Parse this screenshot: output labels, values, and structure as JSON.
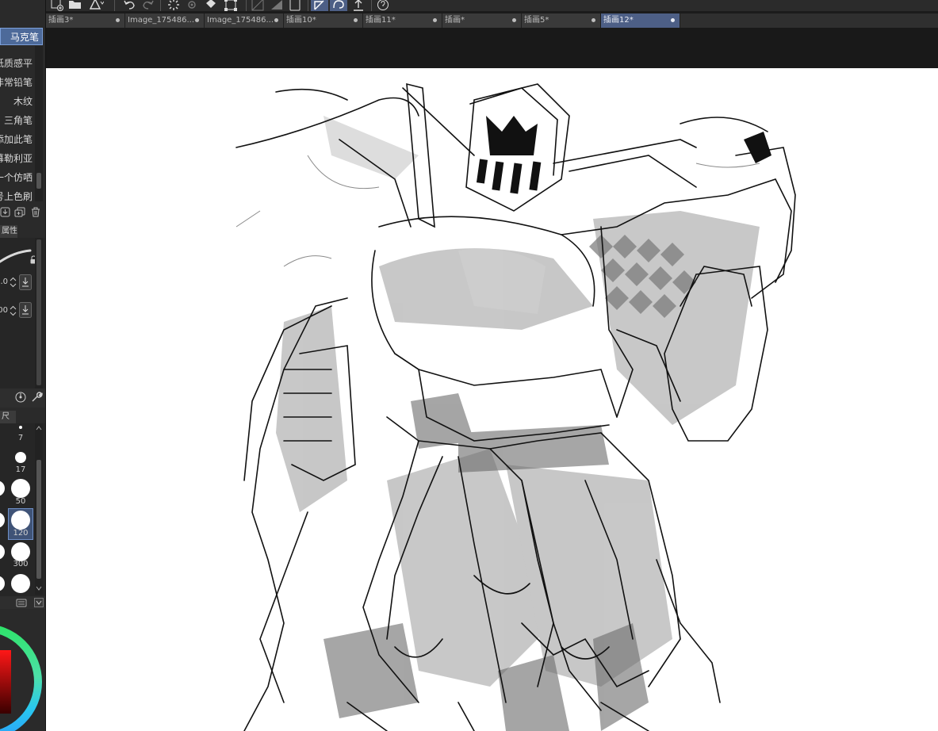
{
  "tabs": [
    {
      "label": "插画3*",
      "active": false
    },
    {
      "label": "Image_175486...",
      "active": false
    },
    {
      "label": "Image_175486...",
      "active": false
    },
    {
      "label": "插画10*",
      "active": false
    },
    {
      "label": "插画11*",
      "active": false
    },
    {
      "label": "插画*",
      "active": false
    },
    {
      "label": "插画5*",
      "active": false
    },
    {
      "label": "插画12*",
      "active": true
    }
  ],
  "brush_list": {
    "selected": "马克笔",
    "items": [
      "纸质感平",
      "非常铅笔",
      "木纹",
      "三角笔",
      "添加此笔",
      "幕勒利亚",
      "一个仿哂",
      "号上色刷"
    ]
  },
  "tool_property": {
    "title": "属性",
    "size_value": "1.0",
    "opacity_value": "100"
  },
  "brush_size": {
    "title": "尺寸",
    "sizes": [
      "7",
      "17",
      "50",
      "120",
      "300"
    ],
    "selected": "120"
  },
  "colors": {
    "accent": "#4d5f86",
    "panel": "#2a2a2a",
    "canvas": "#ffffff"
  },
  "icons": {
    "toolbar": [
      "new-canvas-icon",
      "open-folder-icon",
      "save-icon",
      "undo-icon",
      "redo-icon",
      "loading-icon",
      "settings-icon",
      "fill-icon",
      "transform-icon",
      "clear-icon",
      "eraser-icon",
      "lasso-select-icon",
      "curve-icon",
      "export-icon",
      "help-icon"
    ]
  }
}
